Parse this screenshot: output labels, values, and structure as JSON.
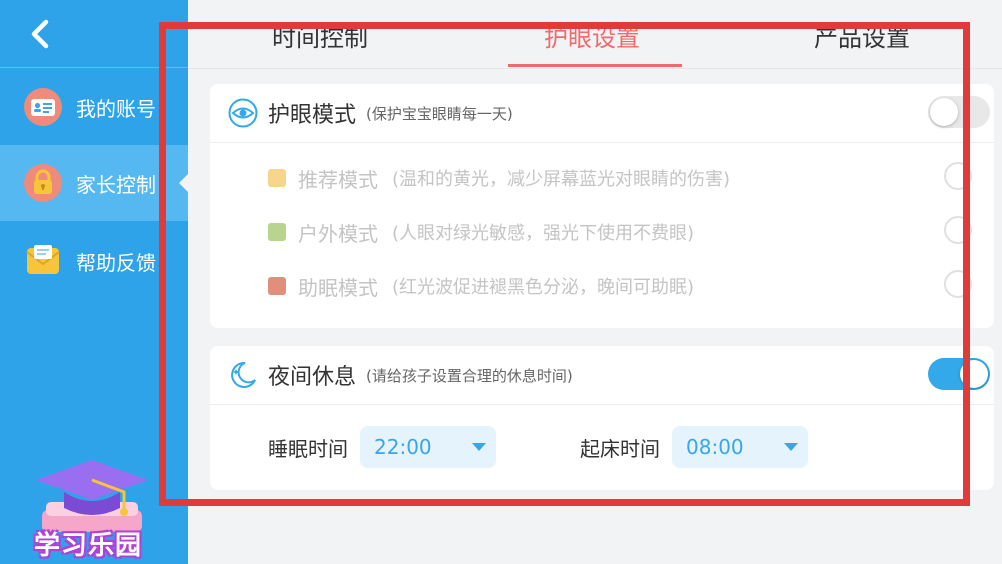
{
  "sidebar": {
    "items": [
      {
        "label": "我的账号",
        "icon": "id-card-icon",
        "active": false
      },
      {
        "label": "家长控制",
        "icon": "lock-icon",
        "active": true
      },
      {
        "label": "帮助反馈",
        "icon": "envelope-icon",
        "active": false
      }
    ],
    "logo_text": "学习乐园"
  },
  "tabs": [
    {
      "label": "时间控制",
      "active": false
    },
    {
      "label": "护眼设置",
      "active": true
    },
    {
      "label": "产品设置",
      "active": false
    }
  ],
  "eye_care": {
    "title": "护眼模式",
    "subtitle": "(保护宝宝眼睛每一天)",
    "enabled": false,
    "modes": [
      {
        "name": "推荐模式",
        "desc": "(温和的黄光，减少屏幕蓝光对眼睛的伤害)",
        "color": "#f7d58a"
      },
      {
        "name": "户外模式",
        "desc": "(人眼对绿光敏感，强光下使用不费眼)",
        "color": "#b9d48e"
      },
      {
        "name": "助眠模式",
        "desc": "(红光波促进褪黑色分泌，晚间可助眠)",
        "color": "#e08f7a"
      }
    ]
  },
  "night_rest": {
    "title": "夜间休息",
    "subtitle": "(请给孩子设置合理的休息时间)",
    "enabled": true,
    "sleep_label": "睡眠时间",
    "sleep_value": "22:00",
    "wake_label": "起床时间",
    "wake_value": "08:00"
  },
  "colors": {
    "sidebar_bg": "#2ea3ea",
    "accent_red": "#f06a6a",
    "toggle_on": "#33a9ea",
    "highlight": "#e03a3a"
  }
}
